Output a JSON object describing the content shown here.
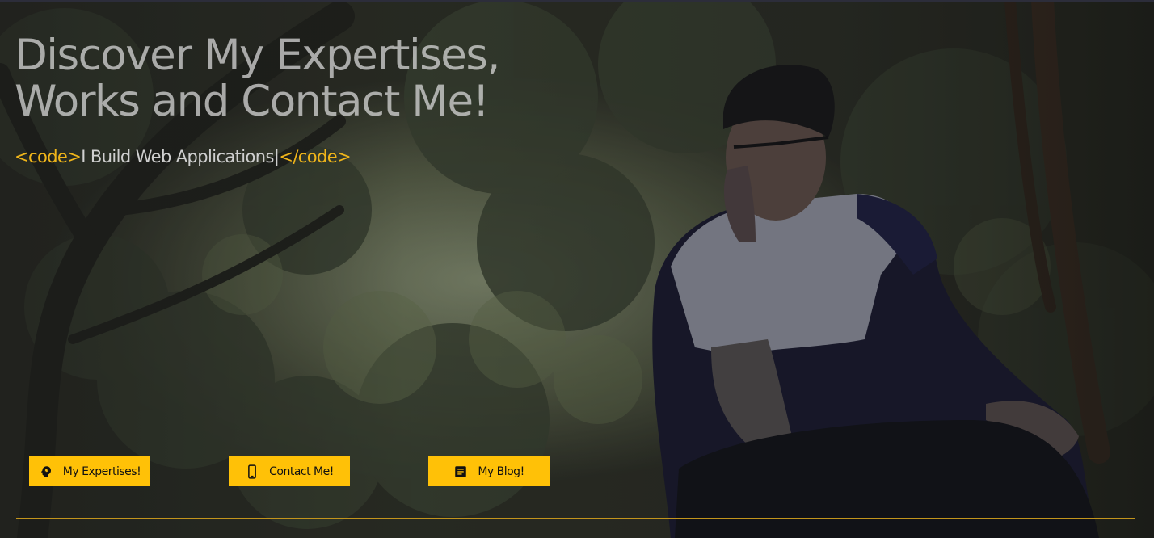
{
  "hero": {
    "headline_line1": "Discover My Expertises,",
    "headline_line2": "Works and Contact Me!",
    "tagline": {
      "open_tag": "<code>",
      "text": "I Build Web Applications|",
      "close_tag": "</code>"
    },
    "background_image": "person-on-phone-in-forest-photo"
  },
  "buttons": {
    "expertises": {
      "label": "My Expertises!",
      "icon": "brain-head-icon"
    },
    "contact": {
      "label": "Contact Me!",
      "icon": "smartphone-icon"
    },
    "blog": {
      "label": "My Blog!",
      "icon": "document-icon"
    }
  },
  "colors": {
    "accent": "#ffc107",
    "tag": "#f0b51a",
    "divider": "#c2941c"
  }
}
